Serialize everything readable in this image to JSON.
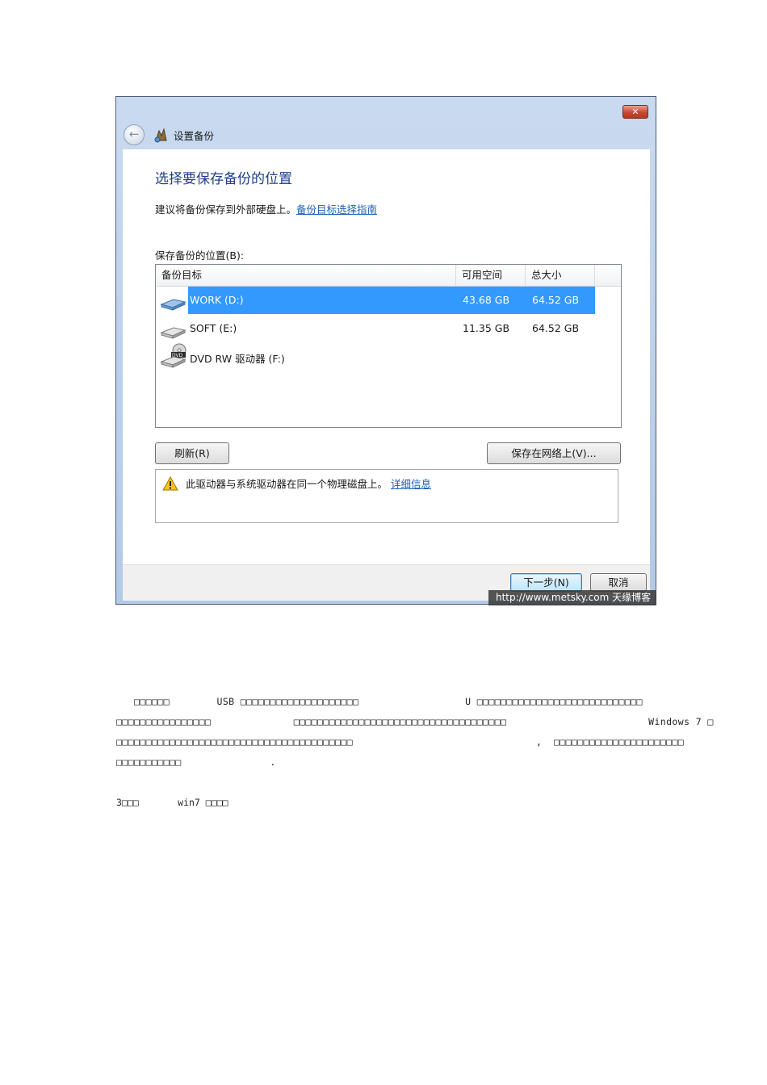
{
  "window": {
    "title": "设置备份",
    "close_label": "✕",
    "back_label": "←"
  },
  "content": {
    "heading": "选择要保存备份的位置",
    "subtitle": "建议将备份保存到外部硬盘上。",
    "subtitle_link": "备份目标选择指南",
    "list_label": "保存备份的位置(B):"
  },
  "listview": {
    "columns": [
      "备份目标",
      "可用空间",
      "总大小"
    ],
    "rows": [
      {
        "name": "WORK (D:)",
        "free": "43.68 GB",
        "total": "64.52 GB",
        "selected": true,
        "icon": "hard-drive-icon"
      },
      {
        "name": "SOFT (E:)",
        "free": "11.35 GB",
        "total": "64.52 GB",
        "selected": false,
        "icon": "hard-drive-icon"
      },
      {
        "name": "DVD RW 驱动器 (F:)",
        "free": "",
        "total": "",
        "selected": false,
        "icon": "dvd-drive-icon"
      }
    ]
  },
  "buttons": {
    "refresh": "刷新(R)",
    "save_network": "保存在网络上(V)...",
    "next": "下一步(N)",
    "cancel": "取消"
  },
  "warning": {
    "text": "此驱动器与系统驱动器在同一个物理磁盘上。",
    "link": "详细信息",
    "icon": "warning-icon"
  },
  "watermark": "http://www.metsky.com  天缘博客",
  "article": {
    "lines": [
      "   □□□□□□        USB □□□□□□□□□□□□□□□□□□□□                  U □□□□□□□□□□□□□□□□□□□□□□□□□□□□",
      "□□□□□□□□□□□□□□□□              □□□□□□□□□□□□□□□□□□□□□□□□□□□□□□□□□□□□                        Windows 7 □",
      "□□□□□□□□□□□□□□□□□□□□□□□□□□□□□□□□□□□□□□□□                               ,  □□□□□□□□□□□□□□□□□□□□□□",
      "□□□□□□□□□□□               ."
    ],
    "section_title": "3□□□       win7 □□□□"
  }
}
